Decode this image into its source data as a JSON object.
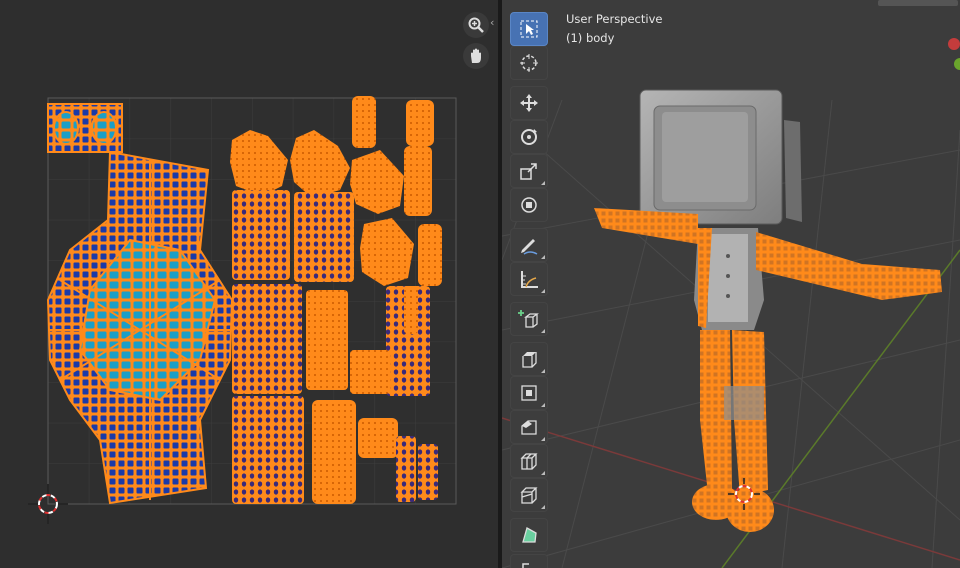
{
  "uv_editor": {
    "tools": [
      "zoom-icon",
      "pan-hand-icon"
    ]
  },
  "viewport": {
    "title": "User Perspective",
    "object_label": "(1) body",
    "tools": [
      {
        "name": "select-box-tool",
        "icon": "select-box-icon",
        "active": true
      },
      {
        "name": "cursor-tool",
        "icon": "cursor-icon",
        "active": false
      },
      {
        "name": "move-tool",
        "icon": "move-icon",
        "active": false
      },
      {
        "name": "rotate-tool",
        "icon": "rotate-icon",
        "active": false
      },
      {
        "name": "scale-tool",
        "icon": "scale-icon",
        "active": false
      },
      {
        "name": "transform-tool",
        "icon": "transform-icon",
        "active": false
      },
      {
        "name": "annotate-tool",
        "icon": "annotate-icon",
        "active": false
      },
      {
        "name": "measure-tool",
        "icon": "measure-icon",
        "active": false
      },
      {
        "name": "add-cube-tool",
        "icon": "add-cube-icon",
        "active": false
      },
      {
        "name": "extrude-tool",
        "icon": "extrude-icon",
        "active": false
      },
      {
        "name": "inset-tool",
        "icon": "inset-icon",
        "active": false
      },
      {
        "name": "bevel-tool",
        "icon": "bevel-icon",
        "active": false
      },
      {
        "name": "loop-cut-tool",
        "icon": "loop-cut-icon",
        "active": false
      },
      {
        "name": "knife-tool",
        "icon": "knife-icon",
        "active": false
      },
      {
        "name": "poly-build-tool",
        "icon": "poly-build-icon",
        "active": false
      },
      {
        "name": "spin-tool",
        "icon": "spin-icon",
        "active": false
      }
    ]
  },
  "colors": {
    "selection_orange": "#ff8a1a",
    "uv_face_blue": "#1a3aa8",
    "uv_face_cyan": "#1aa0c8",
    "active_tool_blue": "#4772b3",
    "mesh_gray": "#9a9a9a"
  }
}
